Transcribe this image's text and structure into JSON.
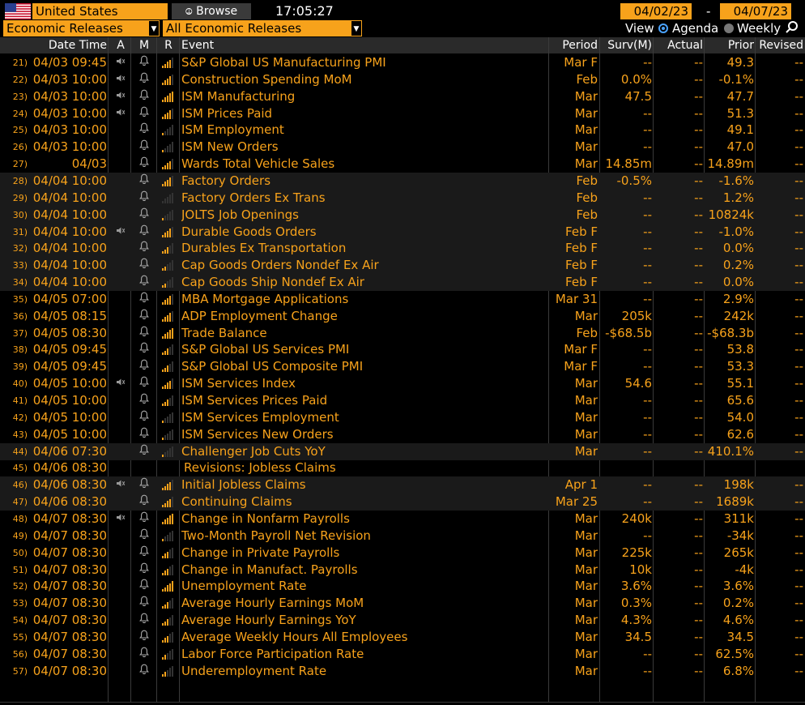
{
  "toolbar": {
    "country": "United States",
    "browse_label": "Browse",
    "time": "17:05:27",
    "start_date": "04/02/23",
    "date_separator": "-",
    "end_date": "04/07/23",
    "category": "Economic Releases",
    "filter": "All Economic Releases",
    "view_label": "View",
    "view_agenda": "Agenda",
    "view_weekly": "Weekly",
    "accent": "#f7a21b"
  },
  "columns": {
    "datetime": "Date Time",
    "a": "A",
    "m": "M",
    "r": "R",
    "event": "Event",
    "period": "Period",
    "survey": "Surv(M)",
    "actual": "Actual",
    "prior": "Prior",
    "revised": "Revised"
  },
  "rows": [
    {
      "n": "21)",
      "dt": "04/03 09:45",
      "alert": true,
      "rel": 4,
      "event": "S&P Global US Manufacturing PMI",
      "period": "Mar F",
      "surv": "--",
      "actual": "--",
      "prior": "49.3",
      "revised": "--",
      "shade": false
    },
    {
      "n": "22)",
      "dt": "04/03 10:00",
      "alert": true,
      "rel": 4,
      "event": "Construction Spending MoM",
      "period": "Feb",
      "surv": "0.0%",
      "actual": "--",
      "prior": "-0.1%",
      "revised": "--",
      "shade": false
    },
    {
      "n": "23)",
      "dt": "04/03 10:00",
      "alert": true,
      "rel": 5,
      "event": "ISM Manufacturing",
      "period": "Mar",
      "surv": "47.5",
      "actual": "--",
      "prior": "47.7",
      "revised": "--",
      "shade": false
    },
    {
      "n": "24)",
      "dt": "04/03 10:00",
      "alert": true,
      "rel": 4,
      "event": "ISM Prices Paid",
      "period": "Mar",
      "surv": "--",
      "actual": "--",
      "prior": "51.3",
      "revised": "--",
      "shade": false
    },
    {
      "n": "25)",
      "dt": "04/03 10:00",
      "alert": false,
      "rel": 1,
      "event": "ISM Employment",
      "period": "Mar",
      "surv": "--",
      "actual": "--",
      "prior": "49.1",
      "revised": "--",
      "shade": false
    },
    {
      "n": "26)",
      "dt": "04/03 10:00",
      "alert": false,
      "rel": 1,
      "event": "ISM New Orders",
      "period": "Mar",
      "surv": "--",
      "actual": "--",
      "prior": "47.0",
      "revised": "--",
      "shade": false
    },
    {
      "n": "27)",
      "dt": "04/03",
      "alert": false,
      "rel": 4,
      "event": "Wards Total Vehicle Sales",
      "period": "Mar",
      "surv": "14.85m",
      "actual": "--",
      "prior": "14.89m",
      "revised": "--",
      "shade": false
    },
    {
      "n": "28)",
      "dt": "04/04 10:00",
      "alert": false,
      "rel": 4,
      "event": "Factory Orders",
      "period": "Feb",
      "surv": "-0.5%",
      "actual": "--",
      "prior": "-1.6%",
      "revised": "--",
      "shade": true
    },
    {
      "n": "29)",
      "dt": "04/04 10:00",
      "alert": false,
      "rel": 0,
      "event": "Factory Orders Ex Trans",
      "period": "Feb",
      "surv": "--",
      "actual": "--",
      "prior": "1.2%",
      "revised": "--",
      "shade": true
    },
    {
      "n": "30)",
      "dt": "04/04 10:00",
      "alert": false,
      "rel": 1,
      "event": "JOLTS Job Openings",
      "period": "Feb",
      "surv": "--",
      "actual": "--",
      "prior": "10824k",
      "revised": "--",
      "shade": true
    },
    {
      "n": "31)",
      "dt": "04/04 10:00",
      "alert": true,
      "rel": 4,
      "event": "Durable Goods Orders",
      "period": "Feb F",
      "surv": "--",
      "actual": "--",
      "prior": "-1.0%",
      "revised": "--",
      "shade": true
    },
    {
      "n": "32)",
      "dt": "04/04 10:00",
      "alert": false,
      "rel": 3,
      "event": "Durables Ex Transportation",
      "period": "Feb F",
      "surv": "--",
      "actual": "--",
      "prior": "0.0%",
      "revised": "--",
      "shade": true
    },
    {
      "n": "33)",
      "dt": "04/04 10:00",
      "alert": false,
      "rel": 2,
      "event": "Cap Goods Orders Nondef Ex Air",
      "period": "Feb F",
      "surv": "--",
      "actual": "--",
      "prior": "0.2%",
      "revised": "--",
      "shade": true
    },
    {
      "n": "34)",
      "dt": "04/04 10:00",
      "alert": false,
      "rel": 2,
      "event": "Cap Goods Ship Nondef Ex Air",
      "period": "Feb F",
      "surv": "--",
      "actual": "--",
      "prior": "0.0%",
      "revised": "--",
      "shade": true
    },
    {
      "n": "35)",
      "dt": "04/05 07:00",
      "alert": false,
      "rel": 4,
      "event": "MBA Mortgage Applications",
      "period": "Mar 31",
      "surv": "--",
      "actual": "--",
      "prior": "2.9%",
      "revised": "--",
      "shade": false
    },
    {
      "n": "36)",
      "dt": "04/05 08:15",
      "alert": false,
      "rel": 4,
      "event": "ADP Employment Change",
      "period": "Mar",
      "surv": "205k",
      "actual": "--",
      "prior": "242k",
      "revised": "--",
      "shade": false
    },
    {
      "n": "37)",
      "dt": "04/05 08:30",
      "alert": false,
      "rel": 5,
      "event": "Trade Balance",
      "period": "Feb",
      "surv": "-$68.5b",
      "actual": "--",
      "prior": "-$68.3b",
      "revised": "--",
      "shade": false
    },
    {
      "n": "38)",
      "dt": "04/05 09:45",
      "alert": false,
      "rel": 3,
      "event": "S&P Global US Services PMI",
      "period": "Mar F",
      "surv": "--",
      "actual": "--",
      "prior": "53.8",
      "revised": "--",
      "shade": false
    },
    {
      "n": "39)",
      "dt": "04/05 09:45",
      "alert": false,
      "rel": 3,
      "event": "S&P Global US Composite PMI",
      "period": "Mar F",
      "surv": "--",
      "actual": "--",
      "prior": "53.3",
      "revised": "--",
      "shade": false
    },
    {
      "n": "40)",
      "dt": "04/05 10:00",
      "alert": true,
      "rel": 4,
      "event": "ISM Services Index",
      "period": "Mar",
      "surv": "54.6",
      "actual": "--",
      "prior": "55.1",
      "revised": "--",
      "shade": false
    },
    {
      "n": "41)",
      "dt": "04/05 10:00",
      "alert": false,
      "rel": 3,
      "event": "ISM Services Prices Paid",
      "period": "Mar",
      "surv": "--",
      "actual": "--",
      "prior": "65.6",
      "revised": "--",
      "shade": false
    },
    {
      "n": "42)",
      "dt": "04/05 10:00",
      "alert": false,
      "rel": 1,
      "event": "ISM Services Employment",
      "period": "Mar",
      "surv": "--",
      "actual": "--",
      "prior": "54.0",
      "revised": "--",
      "shade": false
    },
    {
      "n": "43)",
      "dt": "04/05 10:00",
      "alert": false,
      "rel": 1,
      "event": "ISM Services New Orders",
      "period": "Mar",
      "surv": "--",
      "actual": "--",
      "prior": "62.6",
      "revised": "--",
      "shade": false
    },
    {
      "n": "44)",
      "dt": "04/06 07:30",
      "alert": false,
      "rel": 1,
      "event": "Challenger Job Cuts YoY",
      "period": "Mar",
      "surv": "--",
      "actual": "--",
      "prior": "410.1%",
      "revised": "--",
      "shade": true
    },
    {
      "n": "45)",
      "dt": "04/06 08:30",
      "alert": false,
      "rel": -1,
      "event": "Revisions: Jobless Claims",
      "period": "",
      "surv": "",
      "actual": "",
      "prior": "",
      "revised": "",
      "shade": false,
      "indent": true
    },
    {
      "n": "46)",
      "dt": "04/06 08:30",
      "alert": true,
      "rel": 4,
      "event": "Initial Jobless Claims",
      "period": "Apr 1",
      "surv": "--",
      "actual": "--",
      "prior": "198k",
      "revised": "--",
      "shade": true
    },
    {
      "n": "47)",
      "dt": "04/06 08:30",
      "alert": false,
      "rel": 4,
      "event": "Continuing Claims",
      "period": "Mar 25",
      "surv": "--",
      "actual": "--",
      "prior": "1689k",
      "revised": "--",
      "shade": true
    },
    {
      "n": "48)",
      "dt": "04/07 08:30",
      "alert": true,
      "rel": 5,
      "event": "Change in Nonfarm Payrolls",
      "period": "Mar",
      "surv": "240k",
      "actual": "--",
      "prior": "311k",
      "revised": "--",
      "shade": false
    },
    {
      "n": "49)",
      "dt": "04/07 08:30",
      "alert": false,
      "rel": 1,
      "event": "Two-Month Payroll Net Revision",
      "period": "Mar",
      "surv": "--",
      "actual": "--",
      "prior": "-34k",
      "revised": "--",
      "shade": false
    },
    {
      "n": "50)",
      "dt": "04/07 08:30",
      "alert": false,
      "rel": 3,
      "event": "Change in Private Payrolls",
      "period": "Mar",
      "surv": "225k",
      "actual": "--",
      "prior": "265k",
      "revised": "--",
      "shade": false
    },
    {
      "n": "51)",
      "dt": "04/07 08:30",
      "alert": false,
      "rel": 3,
      "event": "Change in Manufact. Payrolls",
      "period": "Mar",
      "surv": "10k",
      "actual": "--",
      "prior": "-4k",
      "revised": "--",
      "shade": false
    },
    {
      "n": "52)",
      "dt": "04/07 08:30",
      "alert": false,
      "rel": 5,
      "event": "Unemployment Rate",
      "period": "Mar",
      "surv": "3.6%",
      "actual": "--",
      "prior": "3.6%",
      "revised": "--",
      "shade": false
    },
    {
      "n": "53)",
      "dt": "04/07 08:30",
      "alert": false,
      "rel": 3,
      "event": "Average Hourly Earnings MoM",
      "period": "Mar",
      "surv": "0.3%",
      "actual": "--",
      "prior": "0.2%",
      "revised": "--",
      "shade": false
    },
    {
      "n": "54)",
      "dt": "04/07 08:30",
      "alert": false,
      "rel": 3,
      "event": "Average Hourly Earnings YoY",
      "period": "Mar",
      "surv": "4.3%",
      "actual": "--",
      "prior": "4.6%",
      "revised": "--",
      "shade": false
    },
    {
      "n": "55)",
      "dt": "04/07 08:30",
      "alert": false,
      "rel": 3,
      "event": "Average Weekly Hours All Employees",
      "period": "Mar",
      "surv": "34.5",
      "actual": "--",
      "prior": "34.5",
      "revised": "--",
      "shade": false
    },
    {
      "n": "56)",
      "dt": "04/07 08:30",
      "alert": false,
      "rel": 2,
      "event": "Labor Force Participation Rate",
      "period": "Mar",
      "surv": "--",
      "actual": "--",
      "prior": "62.5%",
      "revised": "--",
      "shade": false
    },
    {
      "n": "57)",
      "dt": "04/07 08:30",
      "alert": false,
      "rel": 2,
      "event": "Underemployment Rate",
      "period": "Mar",
      "surv": "--",
      "actual": "--",
      "prior": "6.8%",
      "revised": "--",
      "shade": false
    }
  ]
}
